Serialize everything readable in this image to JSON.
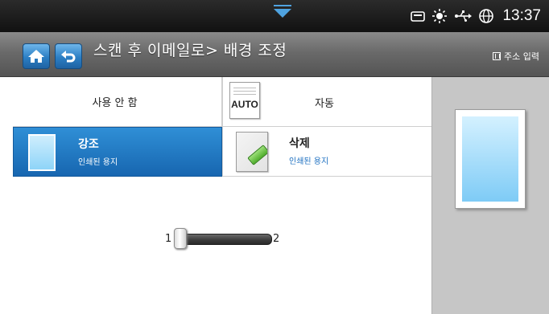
{
  "status": {
    "time": "13:37",
    "icons": [
      "tray-icon",
      "sun-icon",
      "usb-icon",
      "globe-icon"
    ]
  },
  "header": {
    "title": "스캔 후 이메일로> 배경 조정",
    "address_button": "주소 입력"
  },
  "options": {
    "none": {
      "label": "사용 안 함"
    },
    "auto": {
      "thumb_text": "AUTO",
      "label": "자동"
    },
    "enhance": {
      "title": "강조",
      "subtitle": "인쇄된 용지",
      "selected": true
    },
    "erase": {
      "title": "삭제",
      "subtitle": "인쇄된 용지"
    }
  },
  "slider": {
    "min_label": "1",
    "max_label": "2",
    "value": 1
  },
  "colors": {
    "accent": "#1f72bd",
    "header": "#6a6a6a",
    "statusbar": "#1a1a1a",
    "preview_bg": "#c6c6c6"
  }
}
